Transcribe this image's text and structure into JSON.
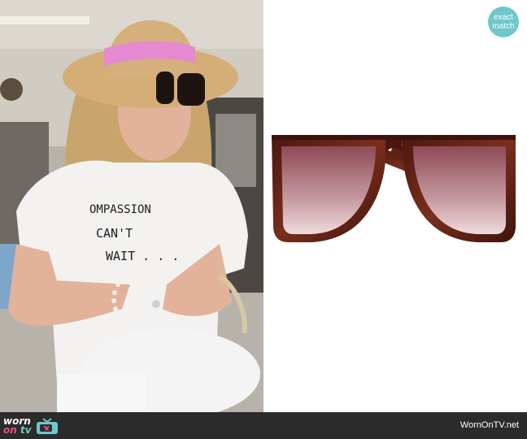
{
  "photo": {
    "shirt_lines": [
      "OMPASSION",
      "CAN'T",
      "WAIT . . ."
    ]
  },
  "badge": {
    "line1": "exact",
    "line2": "match"
  },
  "footer": {
    "logo_word1": "worn",
    "logo_word2": "on",
    "logo_word3": "tv",
    "site_name": "WornOnTV.net"
  },
  "colors": {
    "badge": "#6fc7cc",
    "footer_bg": "#2b2b2b",
    "tortoise_frame": "#5a1e14",
    "lens_tint": "#a0616a",
    "hat_band": "#e58ad0"
  }
}
